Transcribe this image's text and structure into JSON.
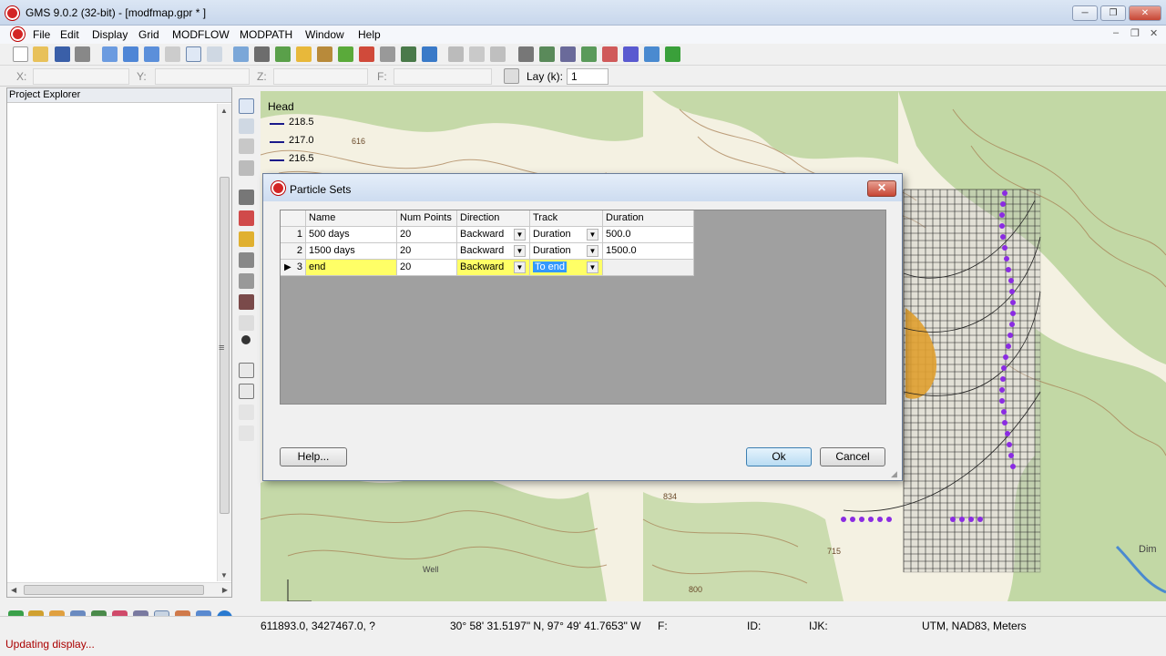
{
  "window": {
    "title": "GMS 9.0.2 (32-bit) - [modfmap.gpr * ]",
    "minimize": "─",
    "maximize": "❐",
    "close": "✕"
  },
  "menu": {
    "items": [
      "File",
      "Edit",
      "Display",
      "Grid",
      "MODFLOW",
      "MODPATH",
      "Window",
      "Help"
    ],
    "mdi_min": "–",
    "mdi_restore": "❐",
    "mdi_close": "✕"
  },
  "coords": {
    "x_label": "X:",
    "y_label": "Y:",
    "z_label": "Z:",
    "f_label": "F:",
    "lay_label": "Lay (k):",
    "lay_value": "1"
  },
  "explorer": {
    "title": "Project Explorer",
    "up_arrow": "▲",
    "down_arrow": "▼",
    "left_arrow": "◀",
    "right_arrow": "▶",
    "grip": "≡"
  },
  "legend": {
    "title": "Head",
    "entries": [
      "218.5",
      "217.0",
      "216.5"
    ]
  },
  "dialog": {
    "title": "Particle Sets",
    "close": "✕",
    "columns": [
      "Name",
      "Num Points",
      "Direction",
      "Track",
      "Duration"
    ],
    "rows": [
      {
        "num": "1",
        "name": "500 days",
        "num_points": "20",
        "direction": "Backward",
        "track": "Duration",
        "duration": "500.0"
      },
      {
        "num": "2",
        "name": "1500 days",
        "num_points": "20",
        "direction": "Backward",
        "track": "Duration",
        "duration": "1500.0"
      },
      {
        "num": "3",
        "name": "end",
        "num_points": "20",
        "direction": "Backward",
        "track": "To end",
        "duration": ""
      }
    ],
    "current_row_marker": "▶",
    "dropdown_glyph": "▼",
    "help_label": "Help...",
    "ok_label": "Ok",
    "cancel_label": "Cancel"
  },
  "status": {
    "xyz": "611893.0, 3427467.0, ?",
    "latlon": "30° 58' 31.5197\" N, 97° 49' 41.7653\" W",
    "f": "F:",
    "id": "ID:",
    "ijk": "IJK:",
    "projection": "UTM, NAD83, Meters",
    "message": "Updating display..."
  },
  "map": {
    "labels": [
      "616",
      "834",
      "800",
      "715",
      "Well",
      "Dim"
    ],
    "colors": {
      "terrain_green": "#b9d39a",
      "paper": "#f4f1e2",
      "contour": "#a57a4e",
      "grid": "#222222",
      "particles": "#8a2be2",
      "zone": "#e0a030",
      "water": "#4a8ad0"
    }
  }
}
